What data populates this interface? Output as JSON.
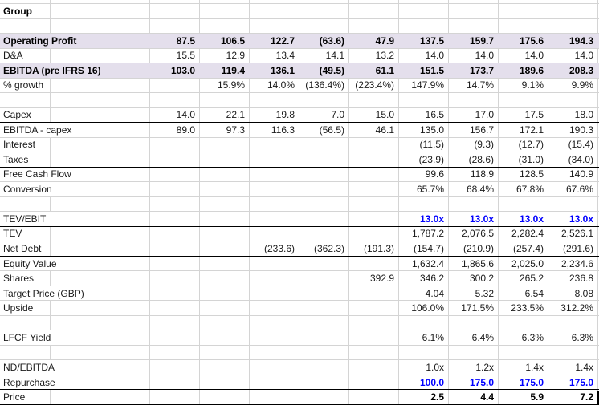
{
  "sheet": {
    "title_cell": "Group",
    "accent_colors": {
      "highlight_fill": "#E4DFEC",
      "link_blue": "#0000ff",
      "gridline": "#d4d4d4"
    },
    "cursor": {
      "name": "cell-cursor",
      "row_index": 26
    },
    "num_data_columns": 9,
    "rows": [
      {
        "label": "Group",
        "span": 1,
        "label_bold": true,
        "values": [
          "",
          "",
          "",
          "",
          "",
          "",
          "",
          "",
          ""
        ]
      },
      {
        "label": "",
        "span": 1,
        "values": [
          "",
          "",
          "",
          "",
          "",
          "",
          "",
          "",
          ""
        ]
      },
      {
        "label": "Operating Profit",
        "span": 2,
        "label_bold": true,
        "fill": true,
        "value_style": "bold",
        "values": [
          "87.5",
          "106.5",
          "122.7",
          "(63.6)",
          "47.9",
          "137.5",
          "159.7",
          "175.6",
          "194.3"
        ]
      },
      {
        "label": "D&A",
        "span": 1,
        "border_bottom": "black",
        "values": [
          "15.5",
          "12.9",
          "13.4",
          "14.1",
          "13.2",
          "14.0",
          "14.0",
          "14.0",
          "14.0"
        ]
      },
      {
        "label": "EBITDA (pre IFRS 16)",
        "span": 3,
        "label_bold": true,
        "fill": true,
        "value_style": "bold",
        "values": [
          "103.0",
          "119.4",
          "136.1",
          "(49.5)",
          "61.1",
          "151.5",
          "173.7",
          "189.6",
          "208.3"
        ]
      },
      {
        "label": "% growth",
        "span": 1,
        "values": [
          "",
          "15.9%",
          "14.0%",
          "(136.4%)",
          "(223.4%)",
          "147.9%",
          "14.7%",
          "9.1%",
          "9.9%"
        ]
      },
      {
        "label": "",
        "span": 1,
        "values": [
          "",
          "",
          "",
          "",
          "",
          "",
          "",
          "",
          ""
        ]
      },
      {
        "label": "Capex",
        "span": 1,
        "border_bottom": "black",
        "values": [
          "14.0",
          "22.1",
          "19.8",
          "7.0",
          "15.0",
          "16.5",
          "17.0",
          "17.5",
          "18.0"
        ]
      },
      {
        "label": "EBITDA - capex",
        "span": 2,
        "values": [
          "89.0",
          "97.3",
          "116.3",
          "(56.5)",
          "46.1",
          "135.0",
          "156.7",
          "172.1",
          "190.3"
        ]
      },
      {
        "label": "Interest",
        "span": 1,
        "values": [
          "",
          "",
          "",
          "",
          "",
          "(11.5)",
          "(9.3)",
          "(12.7)",
          "(15.4)"
        ]
      },
      {
        "label": "Taxes",
        "span": 1,
        "border_bottom": "black",
        "values": [
          "",
          "",
          "",
          "",
          "",
          "(23.9)",
          "(28.6)",
          "(31.0)",
          "(34.0)"
        ]
      },
      {
        "label": "Free Cash Flow",
        "span": 2,
        "values": [
          "",
          "",
          "",
          "",
          "",
          "99.6",
          "118.9",
          "128.5",
          "140.9"
        ]
      },
      {
        "label": "Conversion",
        "span": 2,
        "values": [
          "",
          "",
          "",
          "",
          "",
          "65.7%",
          "68.4%",
          "67.8%",
          "67.6%"
        ]
      },
      {
        "label": "",
        "span": 1,
        "values": [
          "",
          "",
          "",
          "",
          "",
          "",
          "",
          "",
          ""
        ]
      },
      {
        "label": "TEV/EBIT",
        "span": 2,
        "border_bottom": "black",
        "value_style": "blue-bold",
        "values": [
          "",
          "",
          "",
          "",
          "",
          "13.0x",
          "13.0x",
          "13.0x",
          "13.0x"
        ]
      },
      {
        "label": "TEV",
        "span": 1,
        "values": [
          "",
          "",
          "",
          "",
          "",
          "1,787.2",
          "2,076.5",
          "2,282.4",
          "2,526.1"
        ]
      },
      {
        "label": "Net Debt",
        "span": 1,
        "border_bottom": "black",
        "values": [
          "",
          "",
          "(233.6)",
          "(362.3)",
          "(191.3)",
          "(154.7)",
          "(210.9)",
          "(257.4)",
          "(291.6)"
        ]
      },
      {
        "label": "Equity Value",
        "span": 2,
        "values": [
          "",
          "",
          "",
          "",
          "",
          "1,632.4",
          "1,865.6",
          "2,025.0",
          "2,234.6"
        ]
      },
      {
        "label": "Shares",
        "span": 1,
        "border_bottom": "black",
        "values": [
          "",
          "",
          "",
          "",
          "392.9",
          "346.2",
          "300.2",
          "265.2",
          "236.8"
        ]
      },
      {
        "label": "Target Price (GBP)",
        "span": 2,
        "values": [
          "",
          "",
          "",
          "",
          "",
          "4.04",
          "5.32",
          "6.54",
          "8.08"
        ]
      },
      {
        "label": "Upside",
        "span": 1,
        "values": [
          "",
          "",
          "",
          "",
          "",
          "106.0%",
          "171.5%",
          "233.5%",
          "312.2%"
        ]
      },
      {
        "label": "",
        "span": 1,
        "values": [
          "",
          "",
          "",
          "",
          "",
          "",
          "",
          "",
          ""
        ]
      },
      {
        "label": "LFCF Yield",
        "span": 2,
        "values": [
          "",
          "",
          "",
          "",
          "",
          "6.1%",
          "6.4%",
          "6.3%",
          "6.3%"
        ]
      },
      {
        "label": "",
        "span": 1,
        "values": [
          "",
          "",
          "",
          "",
          "",
          "",
          "",
          "",
          ""
        ]
      },
      {
        "label": "ND/EBITDA",
        "span": 2,
        "values": [
          "",
          "",
          "",
          "",
          "",
          "1.0x",
          "1.2x",
          "1.4x",
          "1.4x"
        ]
      },
      {
        "label": "Repurchase",
        "span": 2,
        "border_bottom": "black",
        "value_style": "blue-bold",
        "values": [
          "",
          "",
          "",
          "",
          "",
          "100.0",
          "175.0",
          "175.0",
          "175.0"
        ]
      },
      {
        "label": "Price",
        "span": 1,
        "border_bottom": "black",
        "value_style": "bold",
        "values": [
          "",
          "",
          "",
          "",
          "",
          "2.5",
          "4.4",
          "5.9",
          "7.2"
        ]
      }
    ]
  }
}
